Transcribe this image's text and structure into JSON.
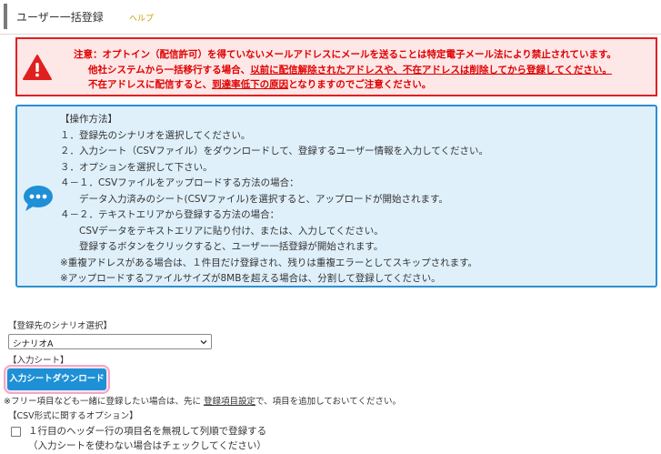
{
  "header": {
    "title": "ユーザー一括登録",
    "help": "ヘルプ"
  },
  "warning": {
    "line1": "注意：オプトイン（配信許可）を得ていないメールアドレスにメールを送ることは特定電子メール法により禁止されています。",
    "line2_a": "他社システムから一括移行する場合、",
    "line2_b": "以前に配信解除されたアドレスや、不在アドレスは削除してから登録してください。",
    "line3_a": "不在アドレスに配信すると、",
    "line3_b": "到達率低下の原因",
    "line3_c": "となりますのでご注意ください。"
  },
  "instructions": {
    "lines": [
      "【操作方法】",
      "１．登録先のシナリオを選択してください。",
      "２．入力シート（CSVファイル）をダウンロードして、登録するユーザー情報を入力してください。",
      "３．オプションを選択して下さい。",
      "４－１．CSVファイルをアップロードする方法の場合：",
      "　　データ入力済みのシート(CSVファイル)を選択すると、アップロードが開始されます。",
      "４－２．テキストエリアから登録する方法の場合：",
      "　　CSVデータをテキストエリアに貼り付け、または、入力してください。",
      "　　登録するボタンをクリックすると、ユーザー一括登録が開始されます。",
      "※重複アドレスがある場合は、１件目だけ登録され、残りは重複エラーとしてスキップされます。",
      "※アップロードするファイルサイズが8MBを超える場合は、分割して登録してください。"
    ]
  },
  "form": {
    "scenario_label": "【登録先のシナリオ選択】",
    "scenario_value": "シナリオA",
    "input_sheet_label": "【入力シート】",
    "download_button": "入力シートダウンロード",
    "note_a": "※フリー項目なども一緒に登録したい場合は、先に ",
    "note_link": "登録項目設定",
    "note_b": "で、項目を追加しておいてください。",
    "csv_options_label": "【CSV形式に関するオプション】",
    "checkbox_line1": "１行目のヘッダー行の項目名を無視して列順で登録する",
    "checkbox_line2": "（入力シートを使わない場合はチェックしてください）"
  },
  "colors": {
    "warning_red": "#e00000",
    "info_blue": "#2d8fd0",
    "button_blue": "#1e90d6",
    "highlight_pink": "#f3a6c8"
  },
  "icons": {
    "warning": "warning-triangle-icon",
    "info": "chat-bubble-icon",
    "select": "chevron-down-icon"
  }
}
